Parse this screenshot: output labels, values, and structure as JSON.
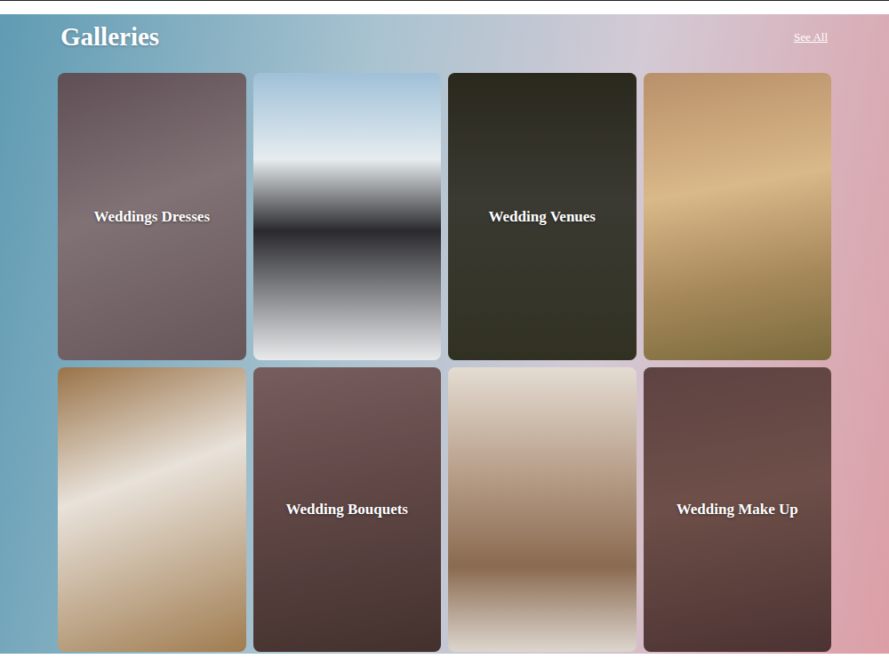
{
  "section": {
    "title": "Galleries",
    "link": "See All"
  },
  "galleries": [
    {
      "label": "Weddings Dresses",
      "overlay": true
    },
    {
      "label": "",
      "overlay": false
    },
    {
      "label": "Wedding Venues",
      "overlay": true
    },
    {
      "label": "",
      "overlay": false
    },
    {
      "label": "",
      "overlay": false
    },
    {
      "label": "Wedding Bouquets",
      "overlay": true
    },
    {
      "label": "",
      "overlay": false
    },
    {
      "label": "Wedding Make Up",
      "overlay": true
    }
  ]
}
